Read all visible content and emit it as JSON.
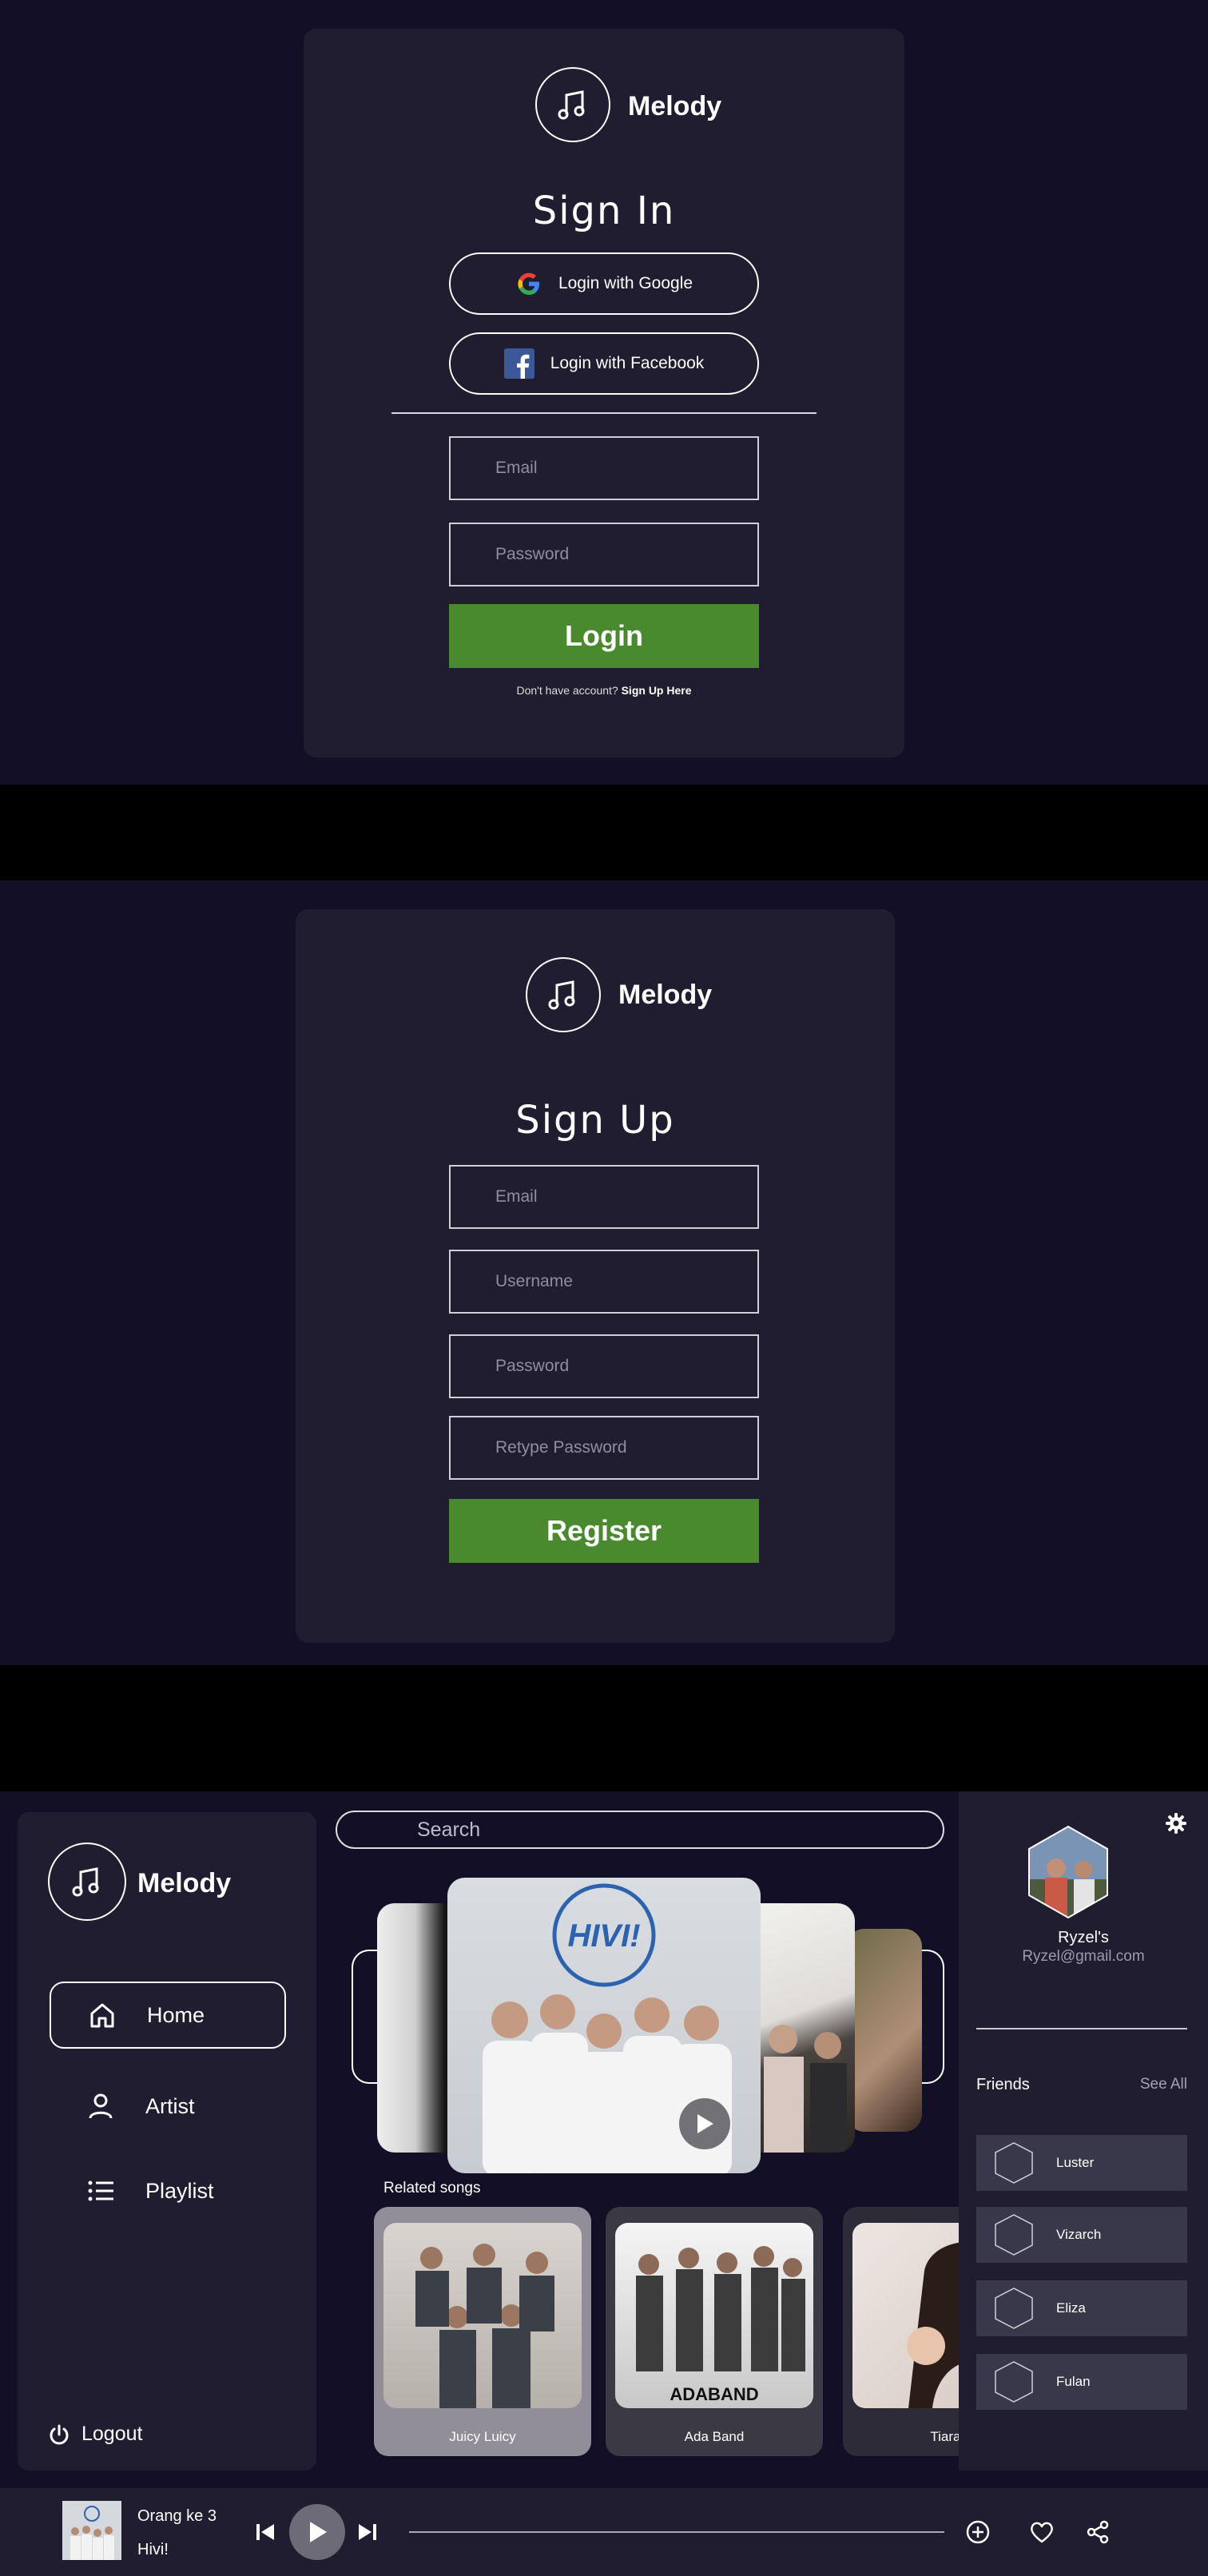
{
  "app": {
    "name": "Melody"
  },
  "signin": {
    "title": "Sign In",
    "google_label": "Login with Google",
    "facebook_label": "Login with Facebook",
    "email_placeholder": "Email",
    "password_placeholder": "Password",
    "login_label": "Login",
    "no_account_text": "Don't have account?",
    "signup_link": "Sign Up Here"
  },
  "signup": {
    "title": "Sign Up",
    "email_placeholder": "Email",
    "username_placeholder": "Username",
    "password_placeholder": "Password",
    "retype_placeholder": "Retype Password",
    "register_label": "Register"
  },
  "dashboard": {
    "nav": {
      "home": "Home",
      "artist": "Artist",
      "playlist": "Playlist",
      "logout": "Logout"
    },
    "search_placeholder": "Search",
    "featured_artist_logo": "HIVI!",
    "related_title": "Related songs",
    "related_songs": [
      {
        "name": "Juicy Luicy"
      },
      {
        "name": "Ada Band",
        "logo": "ADABAND"
      },
      {
        "name": "Tiara A"
      }
    ],
    "profile": {
      "name": "Ryzel's",
      "email": "Ryzel@gmail.com"
    },
    "friends_title": "Friends",
    "see_all": "See All",
    "friends": [
      "Luster",
      "Vizarch",
      "Eliza",
      "Fulan"
    ],
    "player": {
      "song": "Orang ke 3",
      "artist": "Hivi!",
      "progress": 0
    }
  },
  "colors": {
    "background": "#130f26",
    "card": "#201d30",
    "accent_green": "#4a8a2e",
    "friend_row": "#39374a"
  }
}
